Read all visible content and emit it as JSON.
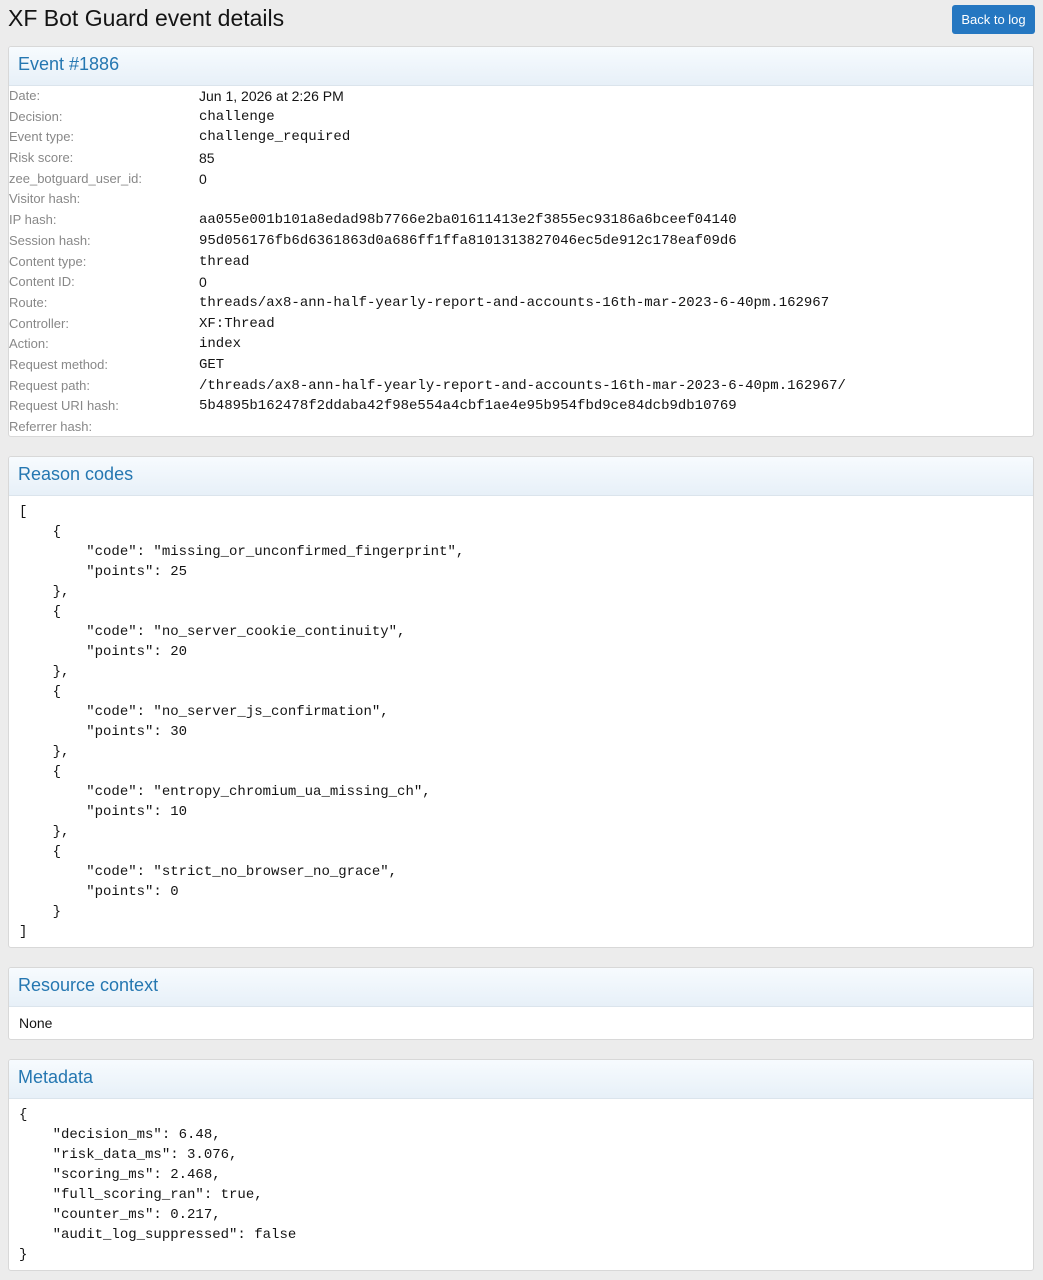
{
  "page": {
    "title": "XF Bot Guard event details",
    "back_button_label": "Back to log"
  },
  "event": {
    "heading": "Event #1886",
    "fields": [
      {
        "label": "Date:",
        "value": "Jun 1, 2026 at 2:26 PM",
        "mono": false
      },
      {
        "label": "Decision:",
        "value": "challenge",
        "mono": true
      },
      {
        "label": "Event type:",
        "value": "challenge_required",
        "mono": true
      },
      {
        "label": "Risk score:",
        "value": "85",
        "mono": false
      },
      {
        "label": "zee_botguard_user_id:",
        "value": "0",
        "mono": false
      },
      {
        "label": "Visitor hash:",
        "value": "",
        "mono": true
      },
      {
        "label": "IP hash:",
        "value": "aa055e001b101a8edad98b7766e2ba01611413e2f3855ec93186a6bceef04140",
        "mono": true
      },
      {
        "label": "Session hash:",
        "value": "95d056176fb6d6361863d0a686ff1ffa8101313827046ec5de912c178eaf09d6",
        "mono": true
      },
      {
        "label": "Content type:",
        "value": "thread",
        "mono": true
      },
      {
        "label": "Content ID:",
        "value": "0",
        "mono": false
      },
      {
        "label": "Route:",
        "value": "threads/ax8-ann-half-yearly-report-and-accounts-16th-mar-2023-6-40pm.162967",
        "mono": true
      },
      {
        "label": "Controller:",
        "value": "XF:Thread",
        "mono": true
      },
      {
        "label": "Action:",
        "value": "index",
        "mono": true
      },
      {
        "label": "Request method:",
        "value": "GET",
        "mono": true
      },
      {
        "label": "Request path:",
        "value": "/threads/ax8-ann-half-yearly-report-and-accounts-16th-mar-2023-6-40pm.162967/",
        "mono": true
      },
      {
        "label": "Request URI hash:",
        "value": "5b4895b162478f2ddaba42f98e554a4cbf1ae4e95b954fbd9ce84dcb9db10769",
        "mono": true
      },
      {
        "label": "Referrer hash:",
        "value": "",
        "mono": true
      }
    ]
  },
  "reason_codes": {
    "heading": "Reason codes",
    "json_text": "[\n    {\n        \"code\": \"missing_or_unconfirmed_fingerprint\",\n        \"points\": 25\n    },\n    {\n        \"code\": \"no_server_cookie_continuity\",\n        \"points\": 20\n    },\n    {\n        \"code\": \"no_server_js_confirmation\",\n        \"points\": 30\n    },\n    {\n        \"code\": \"entropy_chromium_ua_missing_ch\",\n        \"points\": 10\n    },\n    {\n        \"code\": \"strict_no_browser_no_grace\",\n        \"points\": 0\n    }\n]"
  },
  "resource_context": {
    "heading": "Resource context",
    "text": "None"
  },
  "metadata": {
    "heading": "Metadata",
    "json_text": "{\n    \"decision_ms\": 6.48,\n    \"risk_data_ms\": 3.076,\n    \"scoring_ms\": 2.468,\n    \"full_scoring_ran\": true,\n    \"counter_ms\": 0.217,\n    \"audit_log_suppressed\": false\n}"
  }
}
